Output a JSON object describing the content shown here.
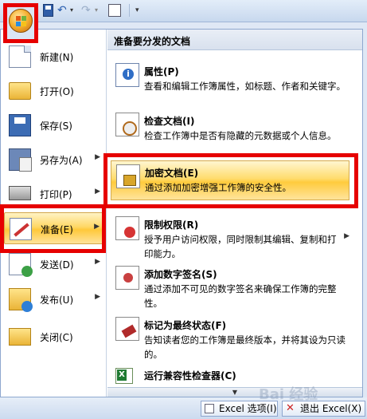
{
  "left_menu": {
    "items": [
      {
        "label": "新建(N)",
        "has_arrow": false
      },
      {
        "label": "打开(O)",
        "has_arrow": false
      },
      {
        "label": "保存(S)",
        "has_arrow": false
      },
      {
        "label": "另存为(A)",
        "has_arrow": true
      },
      {
        "label": "打印(P)",
        "has_arrow": true
      },
      {
        "label": "准备(E)",
        "has_arrow": true
      },
      {
        "label": "发送(D)",
        "has_arrow": true
      },
      {
        "label": "发布(U)",
        "has_arrow": true
      },
      {
        "label": "关闭(C)",
        "has_arrow": false
      }
    ],
    "highlighted": "准备(E)"
  },
  "right_panel": {
    "header": "准备要分发的文档",
    "items": [
      {
        "title": "属性(P)",
        "desc": "查看和编辑工作簿属性，如标题、作者和关键字。"
      },
      {
        "title": "检查文档(I)",
        "desc": "检查工作簿中是否有隐藏的元数据或个人信息。"
      },
      {
        "title": "加密文档(E)",
        "desc": "通过添加加密增强工作簿的安全性。"
      },
      {
        "title": "限制权限(R)",
        "desc": "授予用户访问权限，同时限制其编辑、复制和打印能力。"
      },
      {
        "title": "添加数字签名(S)",
        "desc": "通过添加不可见的数字签名来确保工作簿的完整性。"
      },
      {
        "title": "标记为最终状态(F)",
        "desc": "告知读者您的工作簿是最终版本，并将其设为只读的。"
      },
      {
        "title": "运行兼容性检查器(C)",
        "desc": ""
      }
    ],
    "highlighted": "加密文档(E)"
  },
  "bottom_buttons": {
    "options": "Excel 选项(I)",
    "exit": "退出 Excel(X)"
  },
  "watermark": "Bai 经验",
  "colors": {
    "highlight_red": "#e60000",
    "hover_gold": "#ffd866",
    "panel_header": "#d8e1ee"
  }
}
